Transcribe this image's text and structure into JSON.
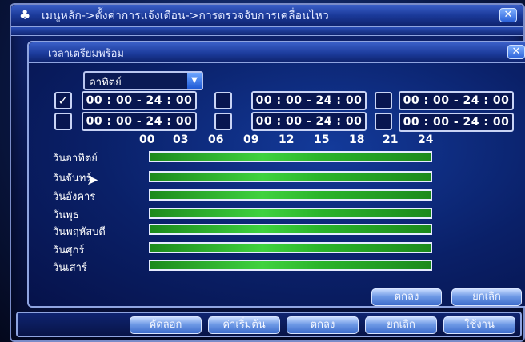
{
  "window": {
    "title": "เมนูหลัก->ตั้งค่าการแจ้งเตือน->การตรวจจับการเคลื่อนไหว",
    "close": "✕"
  },
  "dialog": {
    "title": "เวลาเตรียมพร้อม",
    "close": "✕"
  },
  "day_select": {
    "value": "อาทิตย์"
  },
  "periods": [
    {
      "checked": true,
      "range": "00 : 00 - 24 : 00"
    },
    {
      "checked": false,
      "range": "00 : 00 - 24 : 00"
    },
    {
      "checked": false,
      "range": "00 : 00 - 24 : 00"
    },
    {
      "checked": false,
      "range": "00 : 00 - 24 : 00"
    },
    {
      "checked": false,
      "range": "00 : 00 - 24 : 00"
    },
    {
      "checked": false,
      "range": "00 : 00 - 24 : 00"
    }
  ],
  "hours": [
    "00",
    "03",
    "06",
    "09",
    "12",
    "15",
    "18",
    "21",
    "24"
  ],
  "days": [
    "วันอาทิตย์",
    "วันจันทร์",
    "วันอังคาร",
    "วันพุธ",
    "วันพฤหัสบดี",
    "วันศุกร์",
    "วันเสาร์"
  ],
  "dialog_buttons": {
    "ok": "ตกลง",
    "cancel": "ยกเลิก"
  },
  "bottom_buttons": {
    "copy": "คัดลอก",
    "default": "ค่าเริ่มต้น",
    "ok": "ตกลง",
    "cancel": "ยกเลิก",
    "apply": "ใช้งาน"
  },
  "colors": {
    "active_bar": "#3fd23f",
    "frame": "#8fa4e0",
    "background": "#0a2068"
  }
}
